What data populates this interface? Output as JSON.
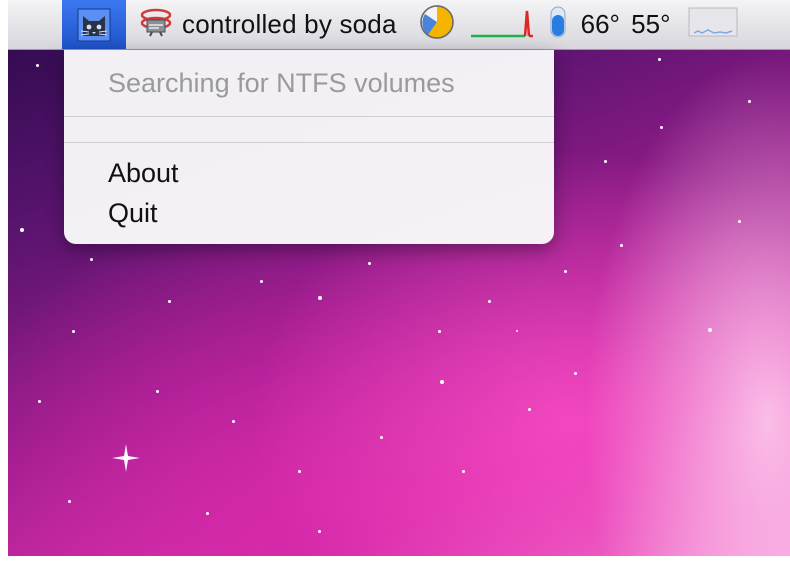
{
  "menubar": {
    "status_text": "controlled by soda",
    "temperatures": "66° 55°"
  },
  "menu": {
    "items": [
      {
        "label": "Searching for NTFS volumes",
        "enabled": false
      },
      {
        "label": "About",
        "enabled": true
      },
      {
        "label": "Quit",
        "enabled": true
      }
    ]
  },
  "icons": {
    "app": "cat-face-icon",
    "status": "sign-icon",
    "pie": "pie-chart-icon",
    "activity": "line-graph-icon",
    "thermometer": "thermometer-icon",
    "mini_graph": "mini-graph-icon"
  },
  "colors": {
    "menubar_highlight": "#2f66e0",
    "pie_fill": "#f5b400",
    "pie_accent": "#2b6fd6",
    "graph_green": "#22b24c",
    "graph_red": "#e12424",
    "thermometer": "#2a7de0"
  }
}
